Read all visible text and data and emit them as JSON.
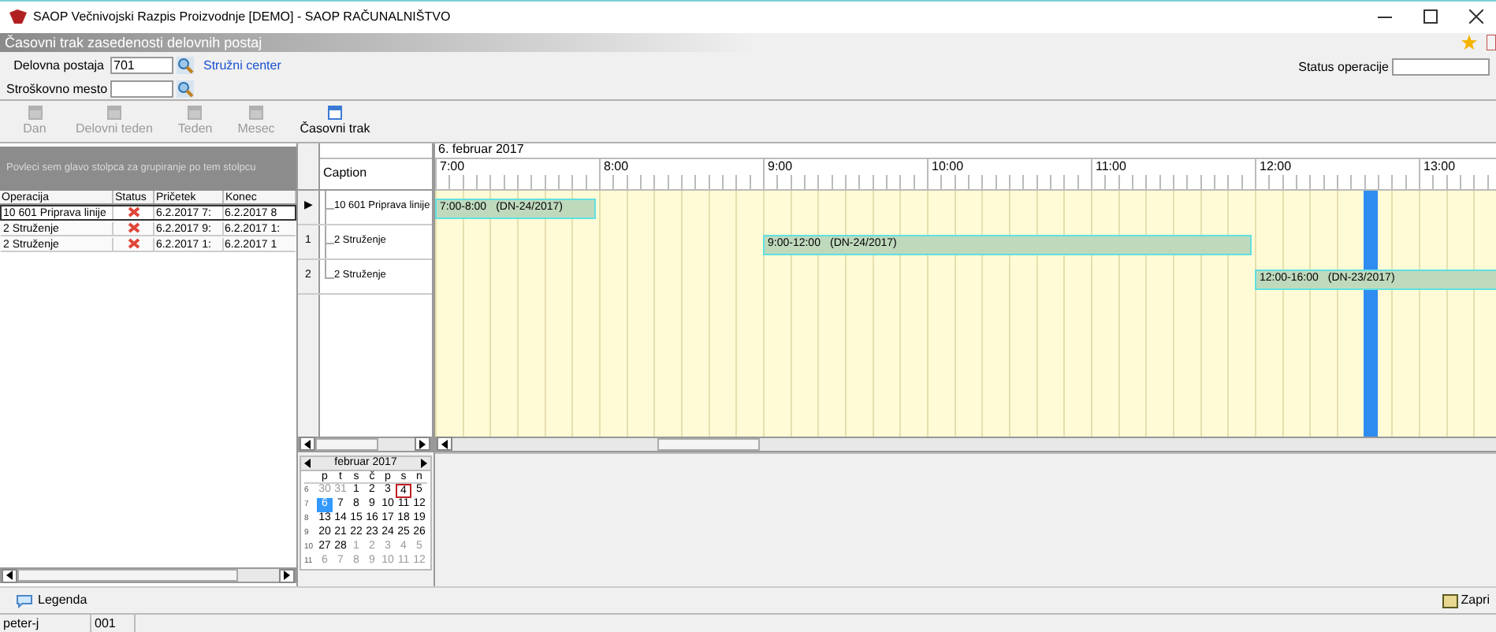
{
  "window": {
    "title": "SAOP  Večnivojski Razpis Proizvodnje [DEMO] - SAOP RAČUNALNIŠTVO"
  },
  "panel_title": "Časovni trak zasedenosti delovnih postaj",
  "filters": {
    "workstation_label": "Delovna postaja",
    "workstation_value": "701",
    "workstation_link": "Stružni center",
    "cost_center_label": "Stroškovno mesto",
    "status_label": "Status operacije"
  },
  "toolbar": [
    {
      "label": "Dan",
      "disabled": true
    },
    {
      "label": "Delovni teden",
      "disabled": true
    },
    {
      "label": "Teden",
      "disabled": true
    },
    {
      "label": "Mesec",
      "disabled": true
    },
    {
      "label": "Časovni trak",
      "disabled": false
    }
  ],
  "group_hint": "Povleci sem glavo stolpca za grupiranje po tem stolpcu",
  "table": {
    "columns": [
      "Operacija",
      "Status",
      "Pričetek",
      "Konec"
    ],
    "rows": [
      {
        "operacija": "10 601 Priprava linije",
        "pricetek": "6.2.2017 7:",
        "konec": "6.2.2017 8",
        "selected": true
      },
      {
        "operacija": "2  Struženje",
        "pricetek": "6.2.2017 9:",
        "konec": "6.2.2017 1:",
        "selected": false
      },
      {
        "operacija": "2  Struženje",
        "pricetek": "6.2.2017 1:",
        "konec": "6.2.2017 1",
        "selected": false
      }
    ]
  },
  "captions": {
    "header": "Caption",
    "rows": [
      {
        "indicator": "▶",
        "label": "10 601 Priprava linije"
      },
      {
        "indicator": "1",
        "label": "2  Struženje"
      },
      {
        "indicator": "2",
        "label": "2  Struženje"
      }
    ]
  },
  "timeline": {
    "date": "6. februar 2017",
    "hours": [
      "7:00",
      "8:00",
      "9:00",
      "10:00",
      "11:00",
      "12:00",
      "13:00"
    ],
    "tasks": [
      {
        "time": "7:00-8:00",
        "order": "(DN-24/2017)"
      },
      {
        "time": "9:00-12:00",
        "order": "(DN-24/2017)"
      },
      {
        "time": "12:00-16:00",
        "order": "(DN-23/2017)"
      }
    ]
  },
  "calendar": {
    "month": "februar 2017",
    "weekdays": [
      "p",
      "t",
      "s",
      "č",
      "p",
      "s",
      "n"
    ],
    "weeks": [
      {
        "number": "6",
        "days": [
          {
            "label": "30",
            "muted": true,
            "selected": false,
            "today": false
          },
          {
            "label": "31",
            "muted": true,
            "selected": false,
            "today": false
          },
          {
            "label": "1",
            "muted": false,
            "selected": false,
            "today": false
          },
          {
            "label": "2",
            "muted": false,
            "selected": false,
            "today": false
          },
          {
            "label": "3",
            "muted": false,
            "selected": false,
            "today": false
          },
          {
            "label": "4",
            "muted": false,
            "selected": false,
            "today": true
          },
          {
            "label": "5",
            "muted": false,
            "selected": false,
            "today": false
          }
        ]
      },
      {
        "number": "7",
        "days": [
          {
            "label": "6",
            "muted": false,
            "selected": true,
            "today": false
          },
          {
            "label": "7",
            "muted": false,
            "selected": false,
            "today": false
          },
          {
            "label": "8",
            "muted": false,
            "selected": false,
            "today": false
          },
          {
            "label": "9",
            "muted": false,
            "selected": false,
            "today": false
          },
          {
            "label": "10",
            "muted": false,
            "selected": false,
            "today": false
          },
          {
            "label": "11",
            "muted": false,
            "selected": false,
            "today": false
          },
          {
            "label": "12",
            "muted": false,
            "selected": false,
            "today": false
          }
        ]
      },
      {
        "number": "8",
        "days": [
          {
            "label": "13",
            "muted": false,
            "selected": false,
            "today": false
          },
          {
            "label": "14",
            "muted": false,
            "selected": false,
            "today": false
          },
          {
            "label": "15",
            "muted": false,
            "selected": false,
            "today": false
          },
          {
            "label": "16",
            "muted": false,
            "selected": false,
            "today": false
          },
          {
            "label": "17",
            "muted": false,
            "selected": false,
            "today": false
          },
          {
            "label": "18",
            "muted": false,
            "selected": false,
            "today": false
          },
          {
            "label": "19",
            "muted": false,
            "selected": false,
            "today": false
          }
        ]
      },
      {
        "number": "9",
        "days": [
          {
            "label": "20",
            "muted": false,
            "selected": false,
            "today": false
          },
          {
            "label": "21",
            "muted": false,
            "selected": false,
            "today": false
          },
          {
            "label": "22",
            "muted": false,
            "selected": false,
            "today": false
          },
          {
            "label": "23",
            "muted": false,
            "selected": false,
            "today": false
          },
          {
            "label": "24",
            "muted": false,
            "selected": false,
            "today": false
          },
          {
            "label": "25",
            "muted": false,
            "selected": false,
            "today": false
          },
          {
            "label": "26",
            "muted": false,
            "selected": false,
            "today": false
          }
        ]
      },
      {
        "number": "10",
        "days": [
          {
            "label": "27",
            "muted": false,
            "selected": false,
            "today": false
          },
          {
            "label": "28",
            "muted": false,
            "selected": false,
            "today": false
          },
          {
            "label": "1",
            "muted": true,
            "selected": false,
            "today": false
          },
          {
            "label": "2",
            "muted": true,
            "selected": false,
            "today": false
          },
          {
            "label": "3",
            "muted": true,
            "selected": false,
            "today": false
          },
          {
            "label": "4",
            "muted": true,
            "selected": false,
            "today": false
          },
          {
            "label": "5",
            "muted": true,
            "selected": false,
            "today": false
          }
        ]
      },
      {
        "number": "11",
        "days": [
          {
            "label": "6",
            "muted": true,
            "selected": false,
            "today": false
          },
          {
            "label": "7",
            "muted": true,
            "selected": false,
            "today": false
          },
          {
            "label": "8",
            "muted": true,
            "selected": false,
            "today": false
          },
          {
            "label": "9",
            "muted": true,
            "selected": false,
            "today": false
          },
          {
            "label": "10",
            "muted": true,
            "selected": false,
            "today": false
          },
          {
            "label": "11",
            "muted": true,
            "selected": false,
            "today": false
          },
          {
            "label": "12",
            "muted": true,
            "selected": false,
            "today": false
          }
        ]
      }
    ]
  },
  "footer": {
    "legend": "Legenda",
    "close": "Zapri"
  },
  "status_bar": [
    "peter-j",
    "001"
  ]
}
